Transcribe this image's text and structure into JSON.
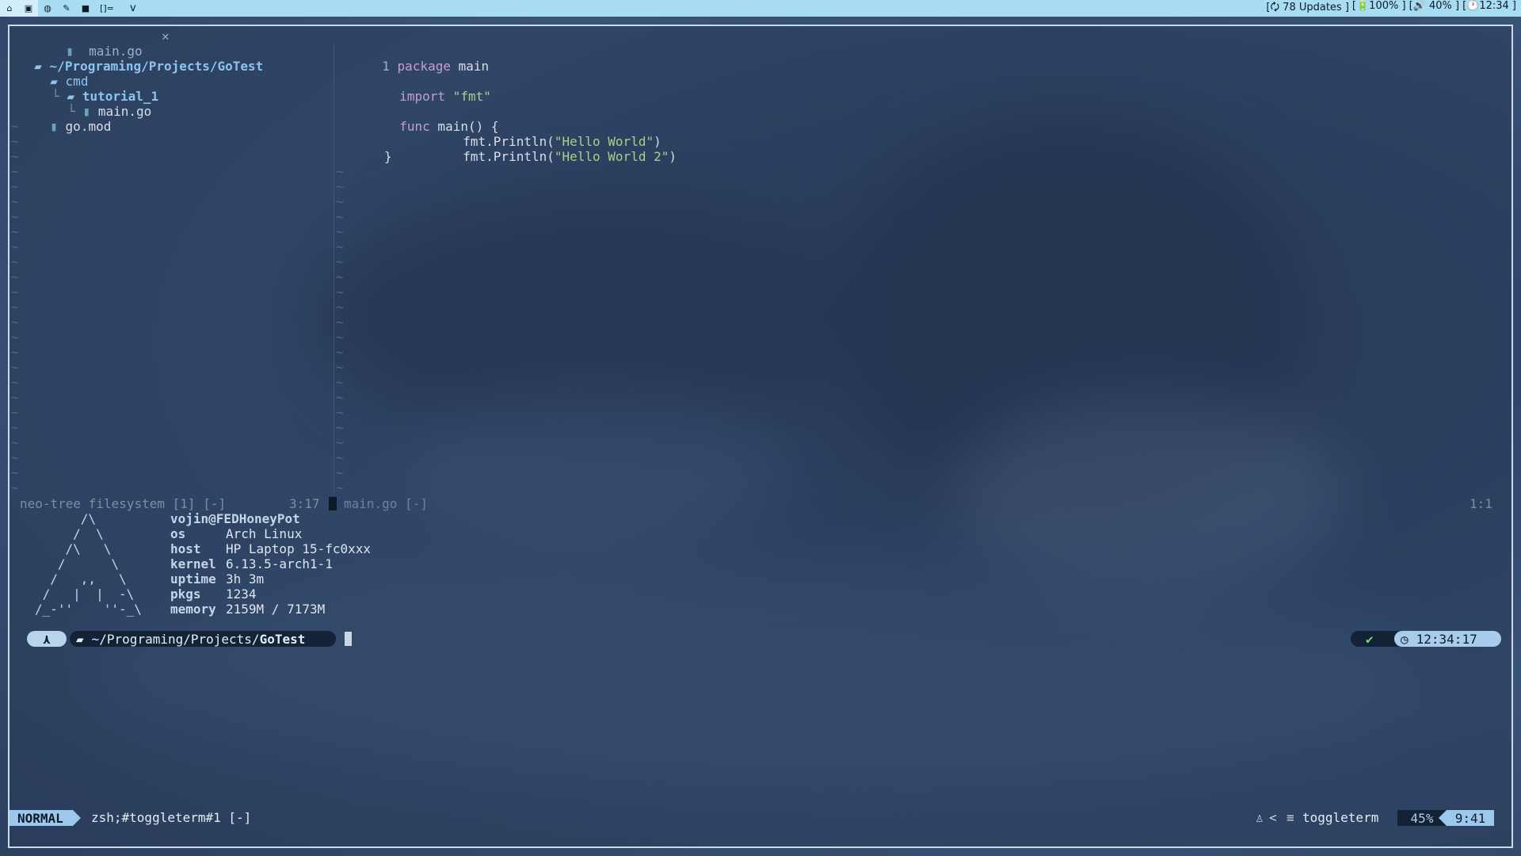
{
  "topbar": {
    "tags": [
      "home-icon",
      "terminal-icon",
      "browser-icon",
      "editor-icon",
      "folder-icon",
      "layout-icon"
    ],
    "layout_symbol": "[]=",
    "window_title": "v",
    "updates": "[🗘 78 Updates ]",
    "battery": "[🔋100% ]",
    "volume": "[🔊 40% ]",
    "clock": "[🕐12:34 ]"
  },
  "tabline": {
    "file": "main.go",
    "close": "✕"
  },
  "tree": {
    "root": "~/Programing/Projects/GoTest",
    "items": [
      {
        "name": "cmd",
        "kind": "dir"
      },
      {
        "name": "tutorial_1",
        "kind": "dir"
      },
      {
        "name": "main.go",
        "kind": "file"
      },
      {
        "name": "go.mod",
        "kind": "file"
      }
    ],
    "prefix_tutorial": "└",
    "prefix_main": "└"
  },
  "code": {
    "line_number": "1",
    "l1_kw": "package",
    "l1_rest": " main",
    "l3_kw": "import",
    "l3_str": "\"fmt\"",
    "l5_kw": "func",
    "l5_rest": " main() {",
    "l6_pre": "fmt.Println(",
    "l6_str": "\"Hello World\"",
    "l6_post": ")",
    "l7_pre": "fmt.Println(",
    "l7_str": "\"Hello World 2\"",
    "l7_post": ")",
    "l8": "}"
  },
  "editor_status": {
    "left": "neo-tree filesystem [1] [-]",
    "left_pos": "3:17",
    "right": "main.go [-]",
    "right_pos": "1:1"
  },
  "fetch": {
    "user": "vojin@FEDHoneyPot",
    "ascii": [
      "      /\\",
      "     /  \\",
      "    /\\   \\",
      "   /      \\",
      "  /   ,,   \\",
      " /   |  |  -\\",
      "/_-''    ''-_\\"
    ],
    "rows": [
      {
        "k": "os",
        "v": "Arch Linux"
      },
      {
        "k": "host",
        "v": "HP Laptop 15-fc0xxx"
      },
      {
        "k": "kernel",
        "v": "6.13.5-arch1-1"
      },
      {
        "k": "uptime",
        "v": "3h 3m"
      },
      {
        "k": "pkgs",
        "v": "1234"
      },
      {
        "k": "memory",
        "v": "2159M / 7173M"
      }
    ]
  },
  "prompt": {
    "icon": "⋏",
    "path_prefix": "~/Programing/Projects/",
    "path_bold": "GoTest",
    "check": "✔",
    "time": "12:34:17"
  },
  "statusline": {
    "mode": "NORMAL",
    "buffer": "zsh;#toggleterm#1 [-]",
    "filetype": "toggleterm",
    "percent": "45%",
    "position": "9:41"
  },
  "colors": {
    "accent": "#a8dcf2",
    "mode_bg": "#9dc8ee",
    "bar": "#0c1a26"
  }
}
